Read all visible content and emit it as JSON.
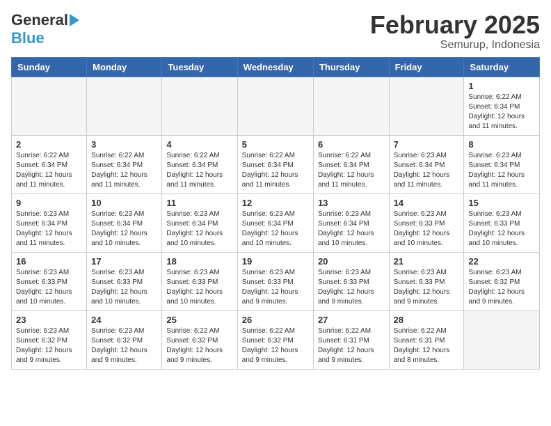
{
  "header": {
    "logo_general": "General",
    "logo_blue": "Blue",
    "month": "February 2025",
    "location": "Semurup, Indonesia"
  },
  "weekdays": [
    "Sunday",
    "Monday",
    "Tuesday",
    "Wednesday",
    "Thursday",
    "Friday",
    "Saturday"
  ],
  "weeks": [
    [
      {
        "day": "",
        "info": ""
      },
      {
        "day": "",
        "info": ""
      },
      {
        "day": "",
        "info": ""
      },
      {
        "day": "",
        "info": ""
      },
      {
        "day": "",
        "info": ""
      },
      {
        "day": "",
        "info": ""
      },
      {
        "day": "1",
        "info": "Sunrise: 6:22 AM\nSunset: 6:34 PM\nDaylight: 12 hours\nand 11 minutes."
      }
    ],
    [
      {
        "day": "2",
        "info": "Sunrise: 6:22 AM\nSunset: 6:34 PM\nDaylight: 12 hours\nand 11 minutes."
      },
      {
        "day": "3",
        "info": "Sunrise: 6:22 AM\nSunset: 6:34 PM\nDaylight: 12 hours\nand 11 minutes."
      },
      {
        "day": "4",
        "info": "Sunrise: 6:22 AM\nSunset: 6:34 PM\nDaylight: 12 hours\nand 11 minutes."
      },
      {
        "day": "5",
        "info": "Sunrise: 6:22 AM\nSunset: 6:34 PM\nDaylight: 12 hours\nand 11 minutes."
      },
      {
        "day": "6",
        "info": "Sunrise: 6:22 AM\nSunset: 6:34 PM\nDaylight: 12 hours\nand 11 minutes."
      },
      {
        "day": "7",
        "info": "Sunrise: 6:23 AM\nSunset: 6:34 PM\nDaylight: 12 hours\nand 11 minutes."
      },
      {
        "day": "8",
        "info": "Sunrise: 6:23 AM\nSunset: 6:34 PM\nDaylight: 12 hours\nand 11 minutes."
      }
    ],
    [
      {
        "day": "9",
        "info": "Sunrise: 6:23 AM\nSunset: 6:34 PM\nDaylight: 12 hours\nand 11 minutes."
      },
      {
        "day": "10",
        "info": "Sunrise: 6:23 AM\nSunset: 6:34 PM\nDaylight: 12 hours\nand 10 minutes."
      },
      {
        "day": "11",
        "info": "Sunrise: 6:23 AM\nSunset: 6:34 PM\nDaylight: 12 hours\nand 10 minutes."
      },
      {
        "day": "12",
        "info": "Sunrise: 6:23 AM\nSunset: 6:34 PM\nDaylight: 12 hours\nand 10 minutes."
      },
      {
        "day": "13",
        "info": "Sunrise: 6:23 AM\nSunset: 6:34 PM\nDaylight: 12 hours\nand 10 minutes."
      },
      {
        "day": "14",
        "info": "Sunrise: 6:23 AM\nSunset: 6:33 PM\nDaylight: 12 hours\nand 10 minutes."
      },
      {
        "day": "15",
        "info": "Sunrise: 6:23 AM\nSunset: 6:33 PM\nDaylight: 12 hours\nand 10 minutes."
      }
    ],
    [
      {
        "day": "16",
        "info": "Sunrise: 6:23 AM\nSunset: 6:33 PM\nDaylight: 12 hours\nand 10 minutes."
      },
      {
        "day": "17",
        "info": "Sunrise: 6:23 AM\nSunset: 6:33 PM\nDaylight: 12 hours\nand 10 minutes."
      },
      {
        "day": "18",
        "info": "Sunrise: 6:23 AM\nSunset: 6:33 PM\nDaylight: 12 hours\nand 10 minutes."
      },
      {
        "day": "19",
        "info": "Sunrise: 6:23 AM\nSunset: 6:33 PM\nDaylight: 12 hours\nand 9 minutes."
      },
      {
        "day": "20",
        "info": "Sunrise: 6:23 AM\nSunset: 6:33 PM\nDaylight: 12 hours\nand 9 minutes."
      },
      {
        "day": "21",
        "info": "Sunrise: 6:23 AM\nSunset: 6:33 PM\nDaylight: 12 hours\nand 9 minutes."
      },
      {
        "day": "22",
        "info": "Sunrise: 6:23 AM\nSunset: 6:32 PM\nDaylight: 12 hours\nand 9 minutes."
      }
    ],
    [
      {
        "day": "23",
        "info": "Sunrise: 6:23 AM\nSunset: 6:32 PM\nDaylight: 12 hours\nand 9 minutes."
      },
      {
        "day": "24",
        "info": "Sunrise: 6:23 AM\nSunset: 6:32 PM\nDaylight: 12 hours\nand 9 minutes."
      },
      {
        "day": "25",
        "info": "Sunrise: 6:22 AM\nSunset: 6:32 PM\nDaylight: 12 hours\nand 9 minutes."
      },
      {
        "day": "26",
        "info": "Sunrise: 6:22 AM\nSunset: 6:32 PM\nDaylight: 12 hours\nand 9 minutes."
      },
      {
        "day": "27",
        "info": "Sunrise: 6:22 AM\nSunset: 6:31 PM\nDaylight: 12 hours\nand 9 minutes."
      },
      {
        "day": "28",
        "info": "Sunrise: 6:22 AM\nSunset: 6:31 PM\nDaylight: 12 hours\nand 8 minutes."
      },
      {
        "day": "",
        "info": ""
      }
    ]
  ]
}
